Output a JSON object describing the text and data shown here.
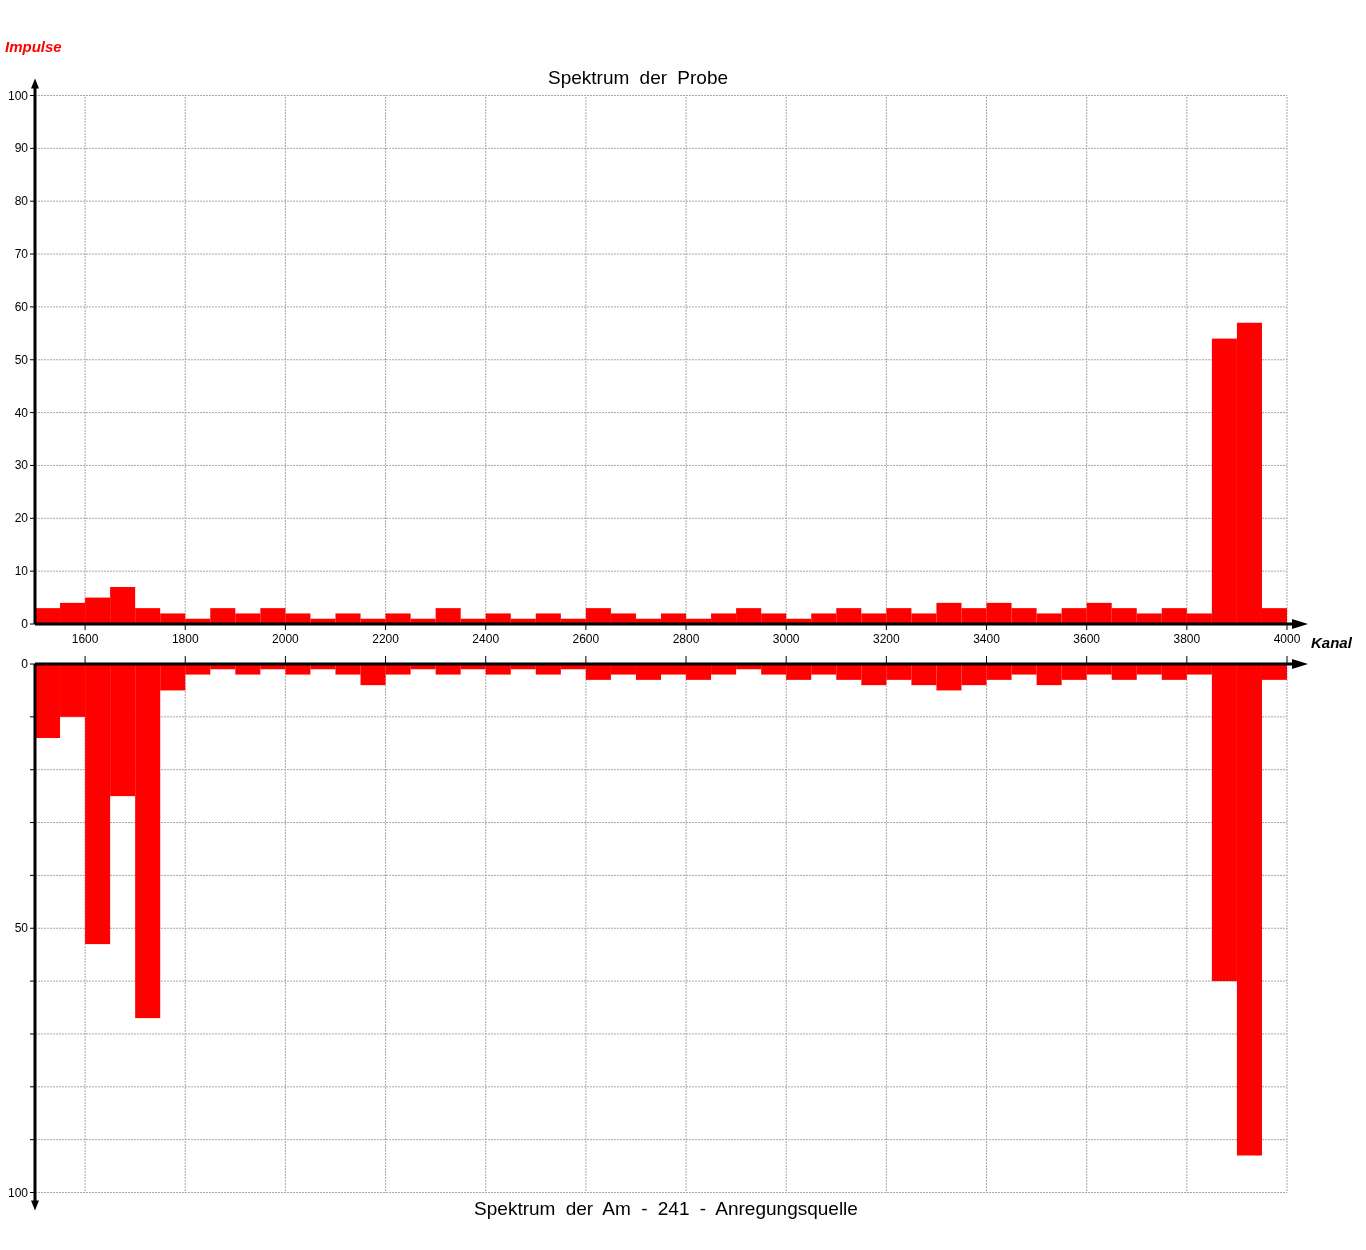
{
  "charts": [
    {
      "chart_data": {
        "type": "bar",
        "title": "Spektrum der Probe",
        "xlabel": "Kanal",
        "ylabel": "Impulse",
        "grid": true,
        "xlim": [
          1500,
          4000
        ],
        "ylim": [
          0,
          100
        ],
        "xticks": [
          1600,
          1800,
          2000,
          2200,
          2400,
          2600,
          2800,
          3000,
          3200,
          3400,
          3600,
          3800,
          4000
        ],
        "yticks": [
          0,
          10,
          20,
          30,
          40,
          50,
          60,
          70,
          80,
          90,
          100
        ],
        "x": [
          1525,
          1575,
          1625,
          1675,
          1725,
          1775,
          1825,
          1875,
          1925,
          1975,
          2025,
          2075,
          2125,
          2175,
          2225,
          2275,
          2325,
          2375,
          2425,
          2475,
          2525,
          2575,
          2625,
          2675,
          2725,
          2775,
          2825,
          2875,
          2925,
          2975,
          3025,
          3075,
          3125,
          3175,
          3225,
          3275,
          3325,
          3375,
          3425,
          3475,
          3525,
          3575,
          3625,
          3675,
          3725,
          3775,
          3825,
          3875,
          3925,
          3975
        ],
        "series": [
          {
            "color": "#ff0000",
            "values": [
              3,
              4,
              5,
              7,
              3,
              2,
              1,
              3,
              2,
              3,
              2,
              1,
              2,
              1,
              2,
              1,
              3,
              1,
              2,
              1,
              2,
              1,
              3,
              2,
              1,
              2,
              1,
              2,
              3,
              2,
              1,
              2,
              3,
              2,
              3,
              2,
              4,
              3,
              4,
              3,
              2,
              3,
              4,
              3,
              2,
              3,
              2,
              54,
              57,
              3
            ]
          }
        ]
      }
    },
    {
      "chart_data": {
        "type": "bar",
        "title": "Spektrum der Am - 241 - Anregungsquelle",
        "grid": true,
        "xlim": [
          1500,
          4000
        ],
        "ylim": [
          100,
          0
        ],
        "yticks": [
          0,
          50,
          100
        ],
        "x": [
          1525,
          1575,
          1625,
          1675,
          1725,
          1775,
          1825,
          1875,
          1925,
          1975,
          2025,
          2075,
          2125,
          2175,
          2225,
          2275,
          2325,
          2375,
          2425,
          2475,
          2525,
          2575,
          2625,
          2675,
          2725,
          2775,
          2825,
          2875,
          2925,
          2975,
          3025,
          3075,
          3125,
          3175,
          3225,
          3275,
          3325,
          3375,
          3425,
          3475,
          3525,
          3575,
          3625,
          3675,
          3725,
          3775,
          3825,
          3875,
          3925,
          3975
        ],
        "series": [
          {
            "color": "#ff0000",
            "values": [
              14,
              10,
              53,
              25,
              67,
              5,
              2,
              1,
              2,
              1,
              2,
              1,
              2,
              4,
              2,
              1,
              2,
              1,
              2,
              1,
              2,
              1,
              3,
              2,
              3,
              2,
              3,
              2,
              1,
              2,
              3,
              2,
              3,
              4,
              3,
              4,
              5,
              4,
              3,
              2,
              4,
              3,
              2,
              3,
              2,
              3,
              2,
              60,
              93,
              3
            ]
          }
        ]
      }
    }
  ]
}
